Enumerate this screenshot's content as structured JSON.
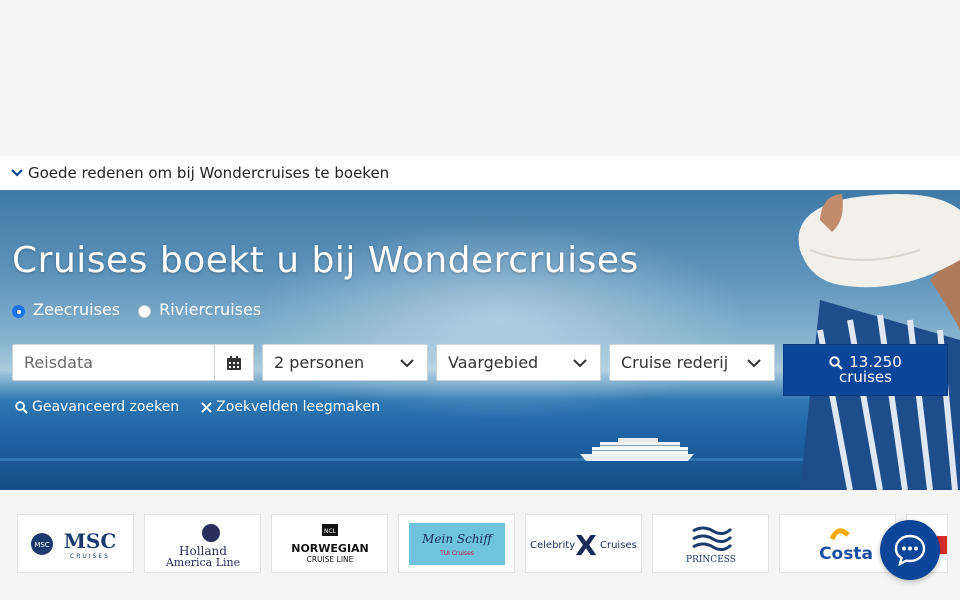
{
  "reasons": {
    "label": "Goede redenen om bij Wondercruises te boeken"
  },
  "hero": {
    "title": "Cruises boekt u bij Wondercruises",
    "cruise_types": [
      {
        "label": "Zeecruises",
        "selected": true
      },
      {
        "label": "Riviercruises",
        "selected": false
      }
    ]
  },
  "search": {
    "travel_dates_placeholder": "Reisdata",
    "persons_value": "2 personen",
    "region_value": "Vaargebied",
    "line_value": "Cruise rederij",
    "button_count": "13.250",
    "button_unit": "cruises"
  },
  "links": {
    "advanced": "Geavanceerd zoeken",
    "clear": "Zoekvelden leegmaken"
  },
  "cruise_lines": [
    {
      "name": "MSC",
      "sub": "CRUISES"
    },
    {
      "name": "Holland",
      "sub": "America Line"
    },
    {
      "name": "NORWEGIAN",
      "sub": "CRUISE LINE"
    },
    {
      "name": "Mein Schiff",
      "sub": "TUI Cruises"
    },
    {
      "name": "Celebrity",
      "sub": "Cruises"
    },
    {
      "name": "PRINCESS",
      "sub": ""
    },
    {
      "name": "Costa",
      "sub": ""
    }
  ],
  "colors": {
    "brand": "#0d4698",
    "text": "#222222"
  }
}
